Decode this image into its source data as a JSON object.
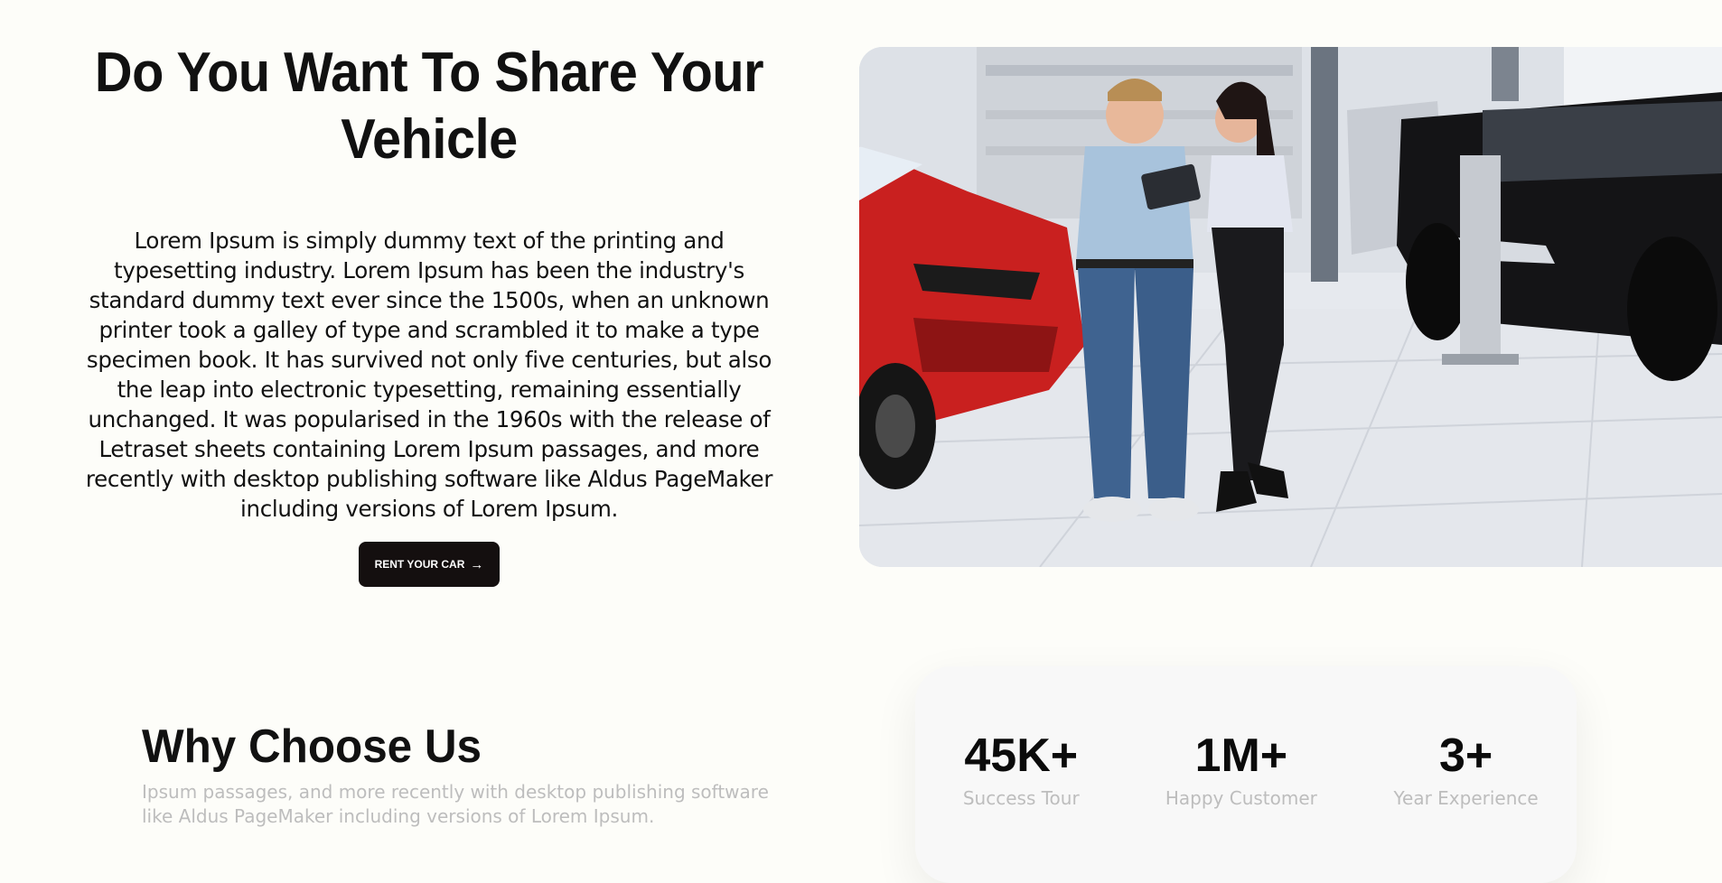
{
  "hero": {
    "title": "Do You Want To Share Your Vehicle",
    "body": "Lorem Ipsum is simply dummy text of the printing and typesetting industry. Lorem Ipsum has been the industry's standard dummy text ever since the 1500s, when an unknown printer took a galley of type and scrambled it to make a type specimen book. It has survived not only five centuries, but also the leap into electronic typesetting, remaining essentially unchanged. It was popularised in the 1960s with the release of Letraset sheets containing Lorem Ipsum passages, and more recently with desktop publishing software like Aldus PageMaker including versions of Lorem Ipsum.",
    "button_label": "RENT YOUR CAR",
    "button_icon": "→"
  },
  "why": {
    "title": "Why Choose Us",
    "subtitle": "Ipsum passages, and more recently with desktop publishing software like Aldus PageMaker including versions of Lorem Ipsum."
  },
  "stats": [
    {
      "value": "45K+",
      "label": "Success Tour"
    },
    {
      "value": "1M+",
      "label": "Happy Customer"
    },
    {
      "value": "3+",
      "label": "Year Experience"
    }
  ],
  "colors": {
    "background": "#fdfdf9",
    "button": "#140f0f",
    "muted_text": "#bdbdbd"
  }
}
